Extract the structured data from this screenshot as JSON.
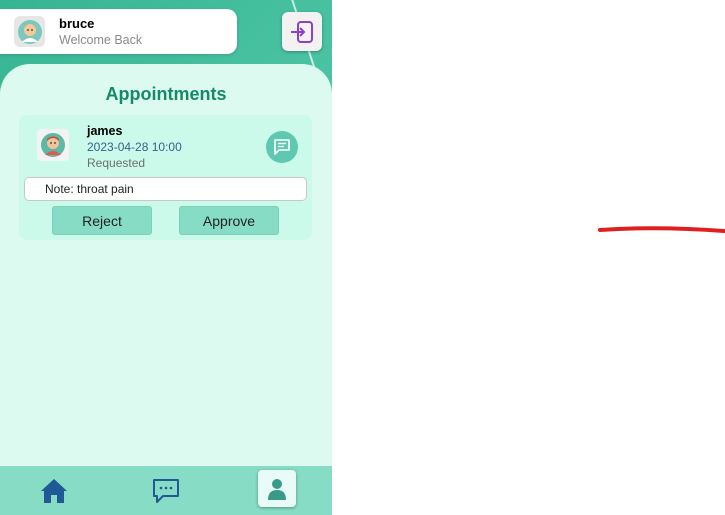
{
  "header": {
    "user_name": "bruce",
    "user_subtitle": "Welcome Back",
    "logout_icon": "logout-icon"
  },
  "main": {
    "title": "Appointments",
    "appointments": [
      {
        "patient_name": "james",
        "datetime": "2023-04-28 10:00",
        "status": "Requested",
        "note": "Note: throat pain",
        "reject_label": "Reject",
        "approve_label": "Approve",
        "chat_icon": "message-icon"
      }
    ]
  },
  "nav": {
    "items": [
      {
        "icon": "home-icon"
      },
      {
        "icon": "chat-icon"
      },
      {
        "icon": "profile-icon",
        "active": true
      }
    ]
  },
  "colors": {
    "accent": "#3fba9a",
    "title": "#168a68",
    "card": "#cbfaeb",
    "button": "#86dcc4",
    "annotation": "#e02020"
  }
}
